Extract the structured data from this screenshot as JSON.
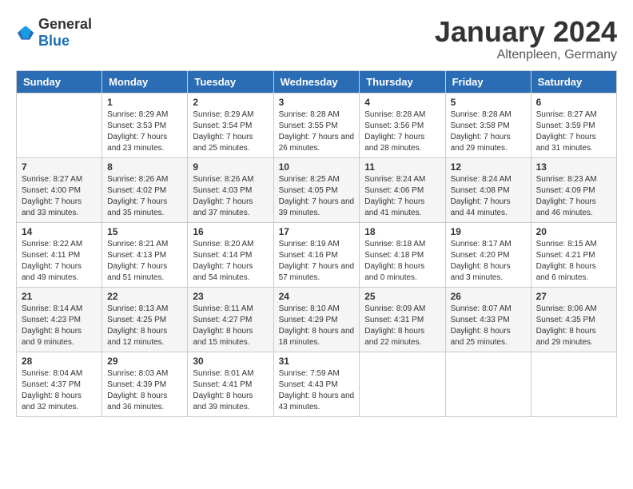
{
  "header": {
    "logo": {
      "general": "General",
      "blue": "Blue"
    },
    "title": "January 2024",
    "subtitle": "Altenpleen, Germany"
  },
  "weekdays": [
    "Sunday",
    "Monday",
    "Tuesday",
    "Wednesday",
    "Thursday",
    "Friday",
    "Saturday"
  ],
  "weeks": [
    [
      {
        "day": "",
        "sunrise": "",
        "sunset": "",
        "daylight": ""
      },
      {
        "day": "1",
        "sunrise": "Sunrise: 8:29 AM",
        "sunset": "Sunset: 3:53 PM",
        "daylight": "Daylight: 7 hours and 23 minutes."
      },
      {
        "day": "2",
        "sunrise": "Sunrise: 8:29 AM",
        "sunset": "Sunset: 3:54 PM",
        "daylight": "Daylight: 7 hours and 25 minutes."
      },
      {
        "day": "3",
        "sunrise": "Sunrise: 8:28 AM",
        "sunset": "Sunset: 3:55 PM",
        "daylight": "Daylight: 7 hours and 26 minutes."
      },
      {
        "day": "4",
        "sunrise": "Sunrise: 8:28 AM",
        "sunset": "Sunset: 3:56 PM",
        "daylight": "Daylight: 7 hours and 28 minutes."
      },
      {
        "day": "5",
        "sunrise": "Sunrise: 8:28 AM",
        "sunset": "Sunset: 3:58 PM",
        "daylight": "Daylight: 7 hours and 29 minutes."
      },
      {
        "day": "6",
        "sunrise": "Sunrise: 8:27 AM",
        "sunset": "Sunset: 3:59 PM",
        "daylight": "Daylight: 7 hours and 31 minutes."
      }
    ],
    [
      {
        "day": "7",
        "sunrise": "Sunrise: 8:27 AM",
        "sunset": "Sunset: 4:00 PM",
        "daylight": "Daylight: 7 hours and 33 minutes."
      },
      {
        "day": "8",
        "sunrise": "Sunrise: 8:26 AM",
        "sunset": "Sunset: 4:02 PM",
        "daylight": "Daylight: 7 hours and 35 minutes."
      },
      {
        "day": "9",
        "sunrise": "Sunrise: 8:26 AM",
        "sunset": "Sunset: 4:03 PM",
        "daylight": "Daylight: 7 hours and 37 minutes."
      },
      {
        "day": "10",
        "sunrise": "Sunrise: 8:25 AM",
        "sunset": "Sunset: 4:05 PM",
        "daylight": "Daylight: 7 hours and 39 minutes."
      },
      {
        "day": "11",
        "sunrise": "Sunrise: 8:24 AM",
        "sunset": "Sunset: 4:06 PM",
        "daylight": "Daylight: 7 hours and 41 minutes."
      },
      {
        "day": "12",
        "sunrise": "Sunrise: 8:24 AM",
        "sunset": "Sunset: 4:08 PM",
        "daylight": "Daylight: 7 hours and 44 minutes."
      },
      {
        "day": "13",
        "sunrise": "Sunrise: 8:23 AM",
        "sunset": "Sunset: 4:09 PM",
        "daylight": "Daylight: 7 hours and 46 minutes."
      }
    ],
    [
      {
        "day": "14",
        "sunrise": "Sunrise: 8:22 AM",
        "sunset": "Sunset: 4:11 PM",
        "daylight": "Daylight: 7 hours and 49 minutes."
      },
      {
        "day": "15",
        "sunrise": "Sunrise: 8:21 AM",
        "sunset": "Sunset: 4:13 PM",
        "daylight": "Daylight: 7 hours and 51 minutes."
      },
      {
        "day": "16",
        "sunrise": "Sunrise: 8:20 AM",
        "sunset": "Sunset: 4:14 PM",
        "daylight": "Daylight: 7 hours and 54 minutes."
      },
      {
        "day": "17",
        "sunrise": "Sunrise: 8:19 AM",
        "sunset": "Sunset: 4:16 PM",
        "daylight": "Daylight: 7 hours and 57 minutes."
      },
      {
        "day": "18",
        "sunrise": "Sunrise: 8:18 AM",
        "sunset": "Sunset: 4:18 PM",
        "daylight": "Daylight: 8 hours and 0 minutes."
      },
      {
        "day": "19",
        "sunrise": "Sunrise: 8:17 AM",
        "sunset": "Sunset: 4:20 PM",
        "daylight": "Daylight: 8 hours and 3 minutes."
      },
      {
        "day": "20",
        "sunrise": "Sunrise: 8:15 AM",
        "sunset": "Sunset: 4:21 PM",
        "daylight": "Daylight: 8 hours and 6 minutes."
      }
    ],
    [
      {
        "day": "21",
        "sunrise": "Sunrise: 8:14 AM",
        "sunset": "Sunset: 4:23 PM",
        "daylight": "Daylight: 8 hours and 9 minutes."
      },
      {
        "day": "22",
        "sunrise": "Sunrise: 8:13 AM",
        "sunset": "Sunset: 4:25 PM",
        "daylight": "Daylight: 8 hours and 12 minutes."
      },
      {
        "day": "23",
        "sunrise": "Sunrise: 8:11 AM",
        "sunset": "Sunset: 4:27 PM",
        "daylight": "Daylight: 8 hours and 15 minutes."
      },
      {
        "day": "24",
        "sunrise": "Sunrise: 8:10 AM",
        "sunset": "Sunset: 4:29 PM",
        "daylight": "Daylight: 8 hours and 18 minutes."
      },
      {
        "day": "25",
        "sunrise": "Sunrise: 8:09 AM",
        "sunset": "Sunset: 4:31 PM",
        "daylight": "Daylight: 8 hours and 22 minutes."
      },
      {
        "day": "26",
        "sunrise": "Sunrise: 8:07 AM",
        "sunset": "Sunset: 4:33 PM",
        "daylight": "Daylight: 8 hours and 25 minutes."
      },
      {
        "day": "27",
        "sunrise": "Sunrise: 8:06 AM",
        "sunset": "Sunset: 4:35 PM",
        "daylight": "Daylight: 8 hours and 29 minutes."
      }
    ],
    [
      {
        "day": "28",
        "sunrise": "Sunrise: 8:04 AM",
        "sunset": "Sunset: 4:37 PM",
        "daylight": "Daylight: 8 hours and 32 minutes."
      },
      {
        "day": "29",
        "sunrise": "Sunrise: 8:03 AM",
        "sunset": "Sunset: 4:39 PM",
        "daylight": "Daylight: 8 hours and 36 minutes."
      },
      {
        "day": "30",
        "sunrise": "Sunrise: 8:01 AM",
        "sunset": "Sunset: 4:41 PM",
        "daylight": "Daylight: 8 hours and 39 minutes."
      },
      {
        "day": "31",
        "sunrise": "Sunrise: 7:59 AM",
        "sunset": "Sunset: 4:43 PM",
        "daylight": "Daylight: 8 hours and 43 minutes."
      },
      {
        "day": "",
        "sunrise": "",
        "sunset": "",
        "daylight": ""
      },
      {
        "day": "",
        "sunrise": "",
        "sunset": "",
        "daylight": ""
      },
      {
        "day": "",
        "sunrise": "",
        "sunset": "",
        "daylight": ""
      }
    ]
  ]
}
